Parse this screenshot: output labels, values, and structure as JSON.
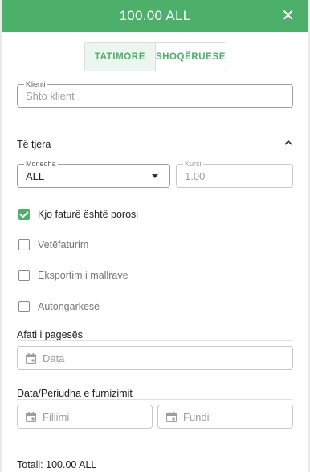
{
  "header": {
    "title": "100.00 ALL",
    "close_label": "✕"
  },
  "toggle": {
    "tatimore": "TATIMORE",
    "shoqeruese": "SHOQËRUESE"
  },
  "client": {
    "label": "Klienti",
    "placeholder": "Shto klient"
  },
  "other": {
    "title": "Të tjera"
  },
  "currency": {
    "label": "Monedha",
    "value": "ALL"
  },
  "rate": {
    "label": "Kursi",
    "value": "1.00"
  },
  "checkboxes": [
    {
      "label": "Kjo faturë është porosi",
      "checked": true
    },
    {
      "label": "Vetëfaturim",
      "checked": false
    },
    {
      "label": "Eksportim i mallrave",
      "checked": false
    },
    {
      "label": "Autongarkesë",
      "checked": false
    }
  ],
  "due": {
    "title": "Afati i pagesës",
    "placeholder": "Data"
  },
  "supply": {
    "title": "Data/Periudha e furnizimit",
    "start_placeholder": "Fillimi",
    "end_placeholder": "Fundi"
  },
  "footer": {
    "total": "Totali: 100.00 ALL"
  },
  "colors": {
    "accent": "#4caf6a"
  },
  "icons": {
    "close": "close-icon",
    "chevron": "chevron-up-icon",
    "calendar": "calendar-icon",
    "check": "check-icon"
  }
}
